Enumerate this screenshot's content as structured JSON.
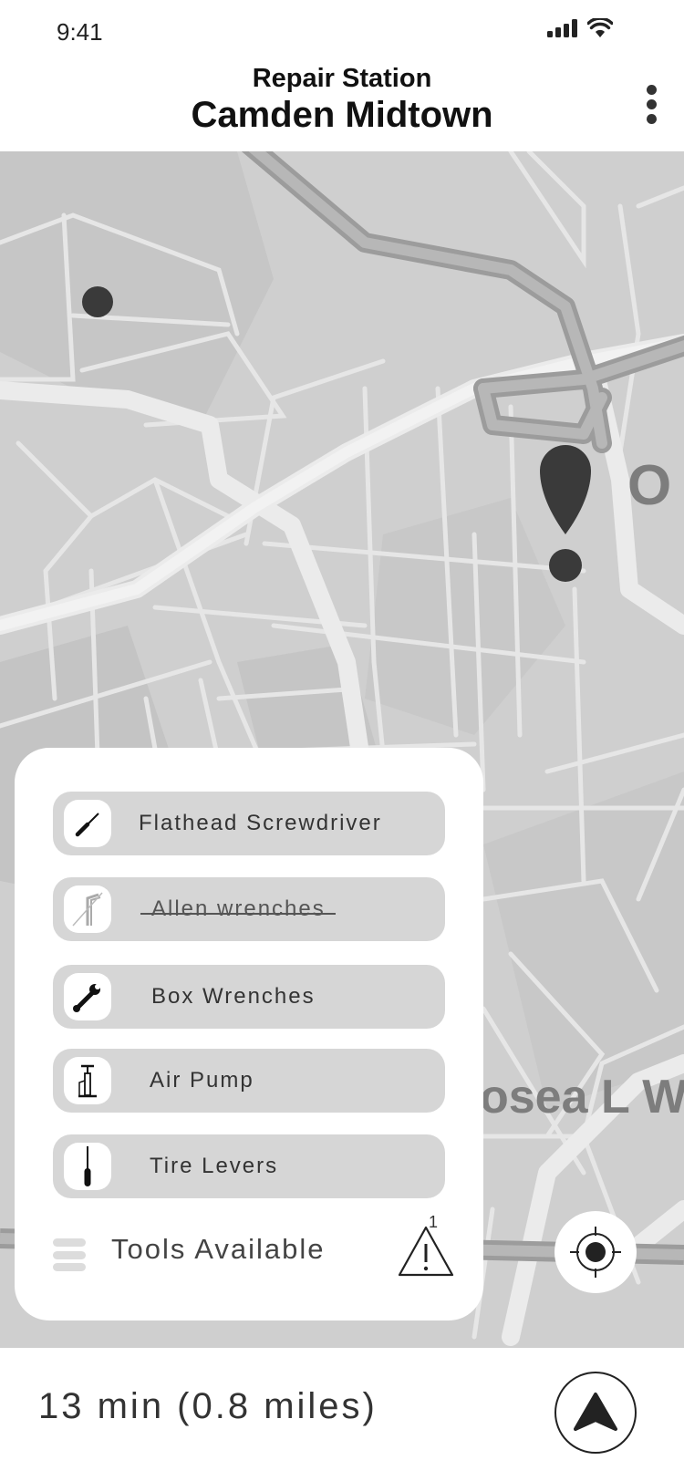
{
  "status_bar": {
    "time": "9:41",
    "icons": [
      "signal-icon",
      "wifi-icon"
    ]
  },
  "header": {
    "subtitle": "Repair Station",
    "title": "Camden Midtown",
    "menu_icon": "more-vertical-icon"
  },
  "map": {
    "labels": [
      "O",
      "osea L W"
    ]
  },
  "tools": [
    {
      "label": "Flathead Screwdriver",
      "icon": "screwdriver-icon",
      "available": true
    },
    {
      "label": "Allen wrenches",
      "icon": "allen-wrench-icon",
      "available": false
    },
    {
      "label": "Box Wrenches",
      "icon": "wrench-icon",
      "available": true
    },
    {
      "label": "Air Pump",
      "icon": "air-pump-icon",
      "available": true
    },
    {
      "label": "Tire Levers",
      "icon": "tire-lever-icon",
      "available": true
    }
  ],
  "panel_footer": {
    "label": "Tools Available",
    "alert_count": "1",
    "menu_icon": "menu-icon",
    "alert_icon": "warning-icon"
  },
  "bottom_bar": {
    "eta": "13 min (0.8 miles)",
    "nav_icon": "navigation-arrow-icon"
  },
  "locate_icon": "crosshair-icon",
  "colors": {
    "map_bg": "#cfcfcf",
    "road": "#e9e9e9",
    "panel": "#ffffff",
    "tool_bg": "#d6d6d6",
    "marker": "#3a3a3a"
  }
}
